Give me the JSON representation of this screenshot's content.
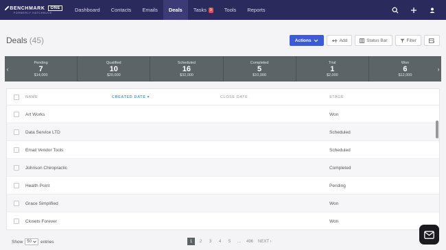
{
  "nav": {
    "logo_text": "BENCHMARK",
    "logo_one": "ONE",
    "logo_sub": "FORMERLY HATCHBUCK",
    "items": [
      {
        "label": "Dashboard"
      },
      {
        "label": "Contacts"
      },
      {
        "label": "Emails"
      },
      {
        "label": "Deals"
      },
      {
        "label": "Tasks",
        "badge": "9"
      },
      {
        "label": "Tools"
      },
      {
        "label": "Reports"
      }
    ],
    "active_item": "Deals",
    "right_icons": [
      "search-icon",
      "plus-icon",
      "user-icon"
    ]
  },
  "page": {
    "title": "Deals",
    "count": "(45)"
  },
  "toolbar": {
    "actions_label": "Actions",
    "add_label": "Add",
    "status_bar_label": "Status Bar",
    "filter_label": "Filter"
  },
  "stages": [
    {
      "name": "Pending",
      "count": "7",
      "amount": "$14,000"
    },
    {
      "name": "Qualified",
      "count": "10",
      "amount": "$20,000"
    },
    {
      "name": "Scheduled",
      "count": "16",
      "amount": "$32,000"
    },
    {
      "name": "Completed",
      "count": "5",
      "amount": "$10,000"
    },
    {
      "name": "Trial",
      "count": "1",
      "amount": "$2,000"
    },
    {
      "name": "Won",
      "count": "6",
      "amount": "$12,000"
    }
  ],
  "table": {
    "columns": [
      "NAME",
      "CREATED DATE ▾",
      "CLOSE DATE",
      "STAGE"
    ],
    "sorted_column": "CREATED DATE",
    "rows": [
      {
        "name": "Art Works",
        "created": "",
        "close": "",
        "stage": "Won"
      },
      {
        "name": "Data Service LTD",
        "created": "",
        "close": "",
        "stage": "Scheduled"
      },
      {
        "name": "Email Vendor Tools",
        "created": "",
        "close": "",
        "stage": "Scheduled"
      },
      {
        "name": "Johnson Chiropractic",
        "created": "",
        "close": "",
        "stage": "Completed"
      },
      {
        "name": "Health Point",
        "created": "",
        "close": "",
        "stage": "Pending"
      },
      {
        "name": "Grace Simplified",
        "created": "",
        "close": "",
        "stage": "Won"
      },
      {
        "name": "Closets Forever",
        "created": "",
        "close": "",
        "stage": "Won"
      }
    ]
  },
  "footer": {
    "show_label": "Show",
    "page_size": "50",
    "entries_label": "entries",
    "pages": [
      "1",
      "2",
      "3",
      "4",
      "5",
      "…",
      "496",
      "NEXT ›"
    ],
    "current_page": "1"
  },
  "colors": {
    "nav_bg": "#2b2a5c",
    "nav_active": "#3c3b78",
    "primary": "#3d5bd9",
    "stage_bg": "#5c6467",
    "sorted": "#4a9dd8"
  }
}
